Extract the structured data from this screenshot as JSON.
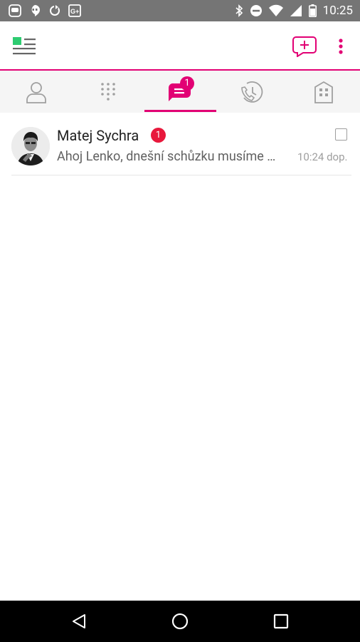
{
  "status_bar": {
    "time": "10:25",
    "left_icons": [
      "messenger-icon",
      "hangouts-icon",
      "sync-icon",
      "google-plus-icon"
    ],
    "right_icons": [
      "bluetooth-icon",
      "do-not-disturb-icon",
      "wifi-icon",
      "signal-icon",
      "battery-icon"
    ]
  },
  "app_bar": {
    "menu_icon": "grid-menu-icon",
    "new_message_icon": "new-message-icon",
    "overflow_icon": "more-vert-icon"
  },
  "tabs": [
    {
      "name": "contacts",
      "icon": "person-icon",
      "active": false
    },
    {
      "name": "dialpad",
      "icon": "dialpad-icon",
      "active": false
    },
    {
      "name": "messages",
      "icon": "chat-icon",
      "active": true,
      "badge": "1"
    },
    {
      "name": "call-history",
      "icon": "phone-history-icon",
      "active": false
    },
    {
      "name": "apps",
      "icon": "building-icon",
      "active": false
    }
  ],
  "conversations": [
    {
      "name": "Matej Sychra",
      "unread": "1",
      "preview": "Ahoj Lenko, dnešní schůzku musíme …",
      "time": "10:24 dop."
    }
  ],
  "colors": {
    "accent": "#e20074",
    "status_bar": "#757575",
    "tab_bar_bg": "#f5f5f5",
    "unread_badge": "#e8183c",
    "menu_green": "#2ecc71",
    "icon_gray": "#a0a0a0",
    "nav_bar": "#000000"
  }
}
